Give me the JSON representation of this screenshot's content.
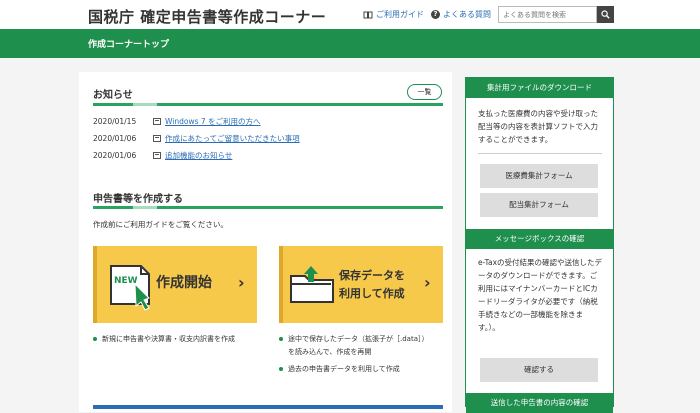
{
  "header": {
    "site_title": "国税庁 確定申告書等作成コーナー",
    "guide_link": "ご利用ガイド",
    "faq_link": "よくある質問",
    "search_placeholder": "よくある質問を検索"
  },
  "nav": {
    "page_title": "作成コーナートップ"
  },
  "news": {
    "title": "お知らせ",
    "more_label": "一覧",
    "items": [
      {
        "date": "2020/01/15",
        "text": "Windows 7 をご利用の方へ"
      },
      {
        "date": "2020/01/06",
        "text": "作成にあたってご留意いただきたい事項"
      },
      {
        "date": "2020/01/06",
        "text": "追加機能のお知らせ"
      }
    ]
  },
  "create": {
    "title": "申告書等を作成する",
    "intro": "作成前にご利用ガイドをご覧ください。",
    "start_card": {
      "badge": "NEW",
      "label": "作成開始"
    },
    "resume_card": {
      "line1": "保存データを",
      "line2": "利用して作成"
    },
    "start_bullets": [
      "新規に申告書や決算書・収支内訳書を作成"
    ],
    "resume_bullets": [
      "途中で保存したデータ（拡張子が［.data］）",
      "を読み込んで、作成を再開",
      "過去の申告書データを利用して作成"
    ]
  },
  "sidebar": {
    "download": {
      "title": "集計用ファイルのダウンロード",
      "text": "支払った医療費の内容や受け取った配当等の内容を表計算ソフトで入力することができます。",
      "buttons": [
        "医療費集計フォーム",
        "配当集計フォーム"
      ]
    },
    "messagebox": {
      "title": "メッセージボックスの確認",
      "text": "e-Taxの受付結果の確認や送信したデータのダウンロードができます。ご利用にはマイナンバーカードとICカードリーダライタが必要です（納税手続きなどの一部機能を除きます。）。",
      "button": "確認する"
    },
    "sent": {
      "title": "送信した申告書の内容の確認"
    }
  },
  "colors": {
    "accent_green": "#1f8f4e",
    "card_yellow": "#f6c94b",
    "link_blue": "#2a6db5"
  },
  "icons": [
    "book-icon",
    "question-icon",
    "search-icon",
    "document-icon",
    "new-document-icon",
    "folder-upload-icon",
    "chevron-right-icon"
  ]
}
